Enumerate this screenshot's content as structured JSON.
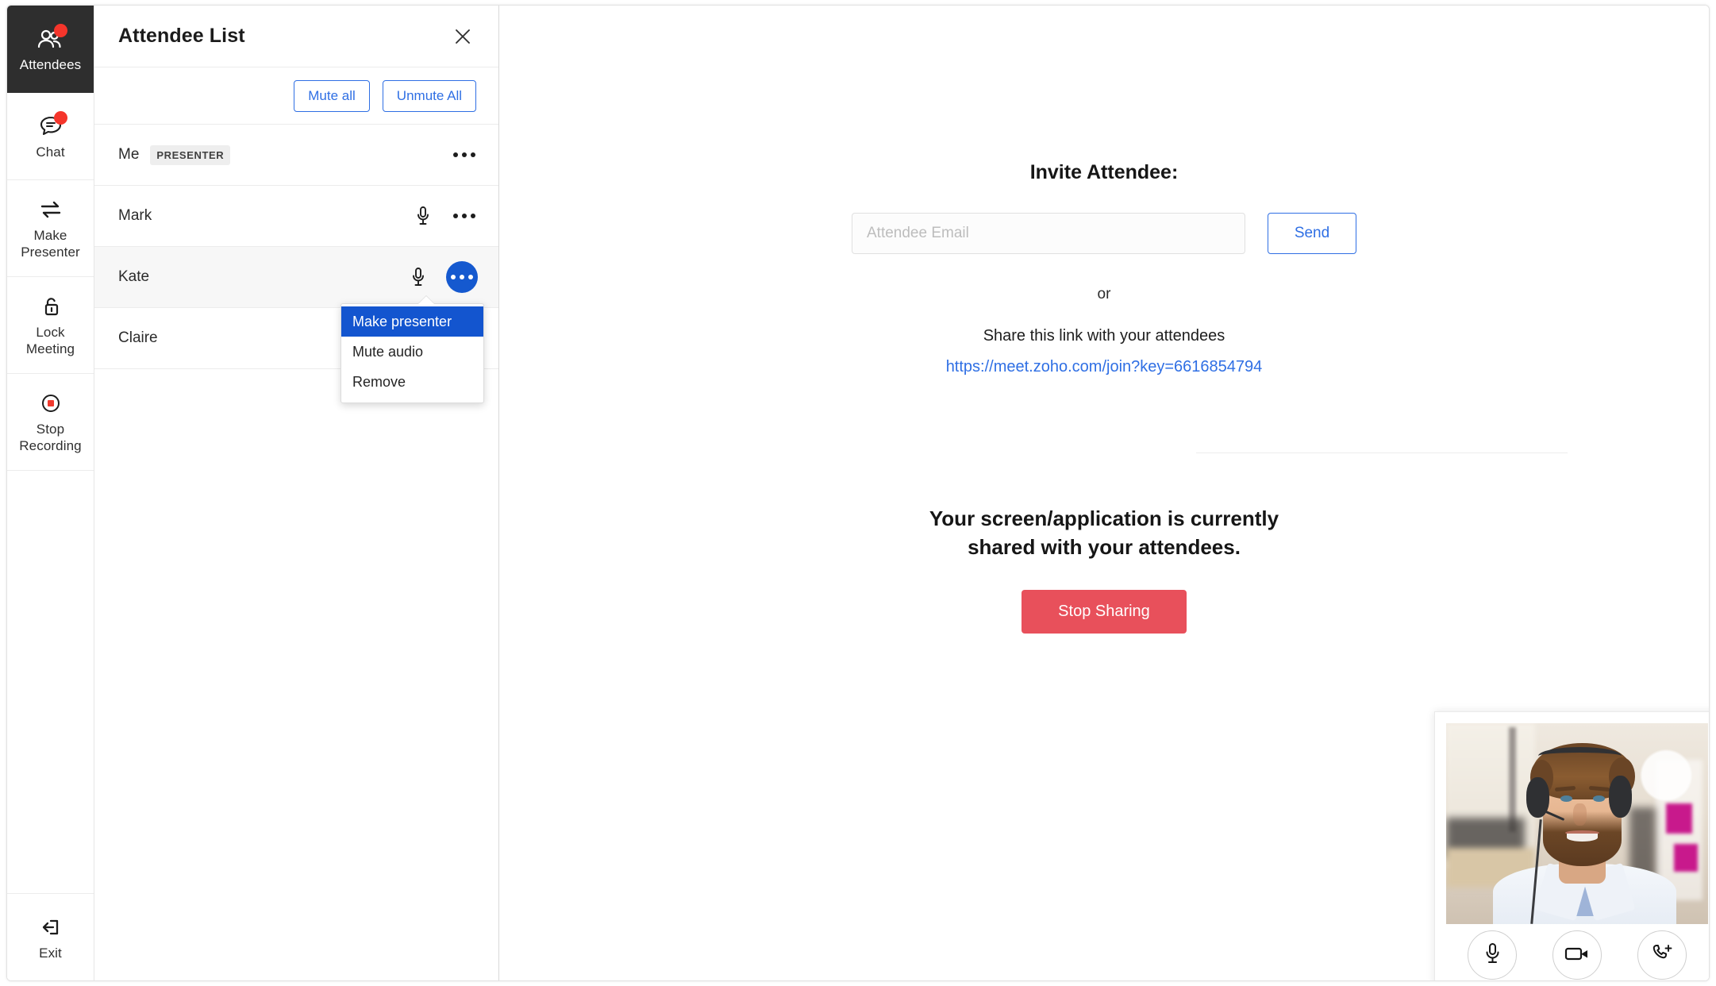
{
  "rail": {
    "items": [
      {
        "label": "Attendees",
        "icon": "people-icon",
        "badge": true,
        "active": true
      },
      {
        "label": "Chat",
        "icon": "chat-bubble-icon",
        "badge": true,
        "active": false
      },
      {
        "label": "Make\nPresenter",
        "label_line1": "Make",
        "label_line2": "Presenter",
        "icon": "swap-arrows-icon",
        "badge": false,
        "active": false
      },
      {
        "label": "Lock\nMeeting",
        "label_line1": "Lock",
        "label_line2": "Meeting",
        "icon": "open-padlock-icon",
        "badge": false,
        "active": false
      },
      {
        "label": "Stop\nRecording",
        "label_line1": "Stop",
        "label_line2": "Recording",
        "icon": "stop-record-icon",
        "badge": false,
        "active": false
      }
    ],
    "exit": {
      "label": "Exit",
      "icon": "exit-arrow-icon"
    }
  },
  "panel": {
    "title": "Attendee List",
    "close_icon": "close-icon",
    "mute_all_label": "Mute all",
    "unmute_all_label": "Unmute All",
    "attendees": [
      {
        "name": "Me",
        "tag": "PRESENTER",
        "has_mic": false,
        "selected": false,
        "menu_open": false
      },
      {
        "name": "Mark",
        "tag": "",
        "has_mic": true,
        "selected": false,
        "menu_open": false
      },
      {
        "name": "Kate",
        "tag": "",
        "has_mic": true,
        "selected": true,
        "menu_open": true
      },
      {
        "name": "Claire",
        "tag": "",
        "has_mic": false,
        "selected": false,
        "menu_open": false
      }
    ],
    "context_menu": {
      "items": [
        {
          "label": "Make presenter",
          "highlighted": true
        },
        {
          "label": "Mute audio",
          "highlighted": false
        },
        {
          "label": "Remove",
          "highlighted": false
        }
      ]
    }
  },
  "main": {
    "invite_title": "Invite Attendee:",
    "email_placeholder": "Attendee Email",
    "email_value": "",
    "send_label": "Send",
    "or_label": "or",
    "share_prompt": "Share this link with your attendees",
    "share_link": "https://meet.zoho.com/join?key=6616854794",
    "share_status_line1": "Your screen/application is currently",
    "share_status_line2": "shared with your attendees.",
    "stop_sharing_label": "Stop Sharing"
  },
  "video": {
    "controls": [
      {
        "icon": "microphone-icon",
        "name": "mute-toggle-button"
      },
      {
        "icon": "video-camera-icon",
        "name": "camera-toggle-button"
      },
      {
        "icon": "phone-add-icon",
        "name": "add-call-button"
      }
    ]
  },
  "colors": {
    "accent_blue": "#2f6fe4",
    "active_blue": "#1559cf",
    "menu_highlight": "#1355cf",
    "danger_red": "#e8505b",
    "badge_red": "#f5352b",
    "rail_active_bg": "#2e2e2e"
  }
}
